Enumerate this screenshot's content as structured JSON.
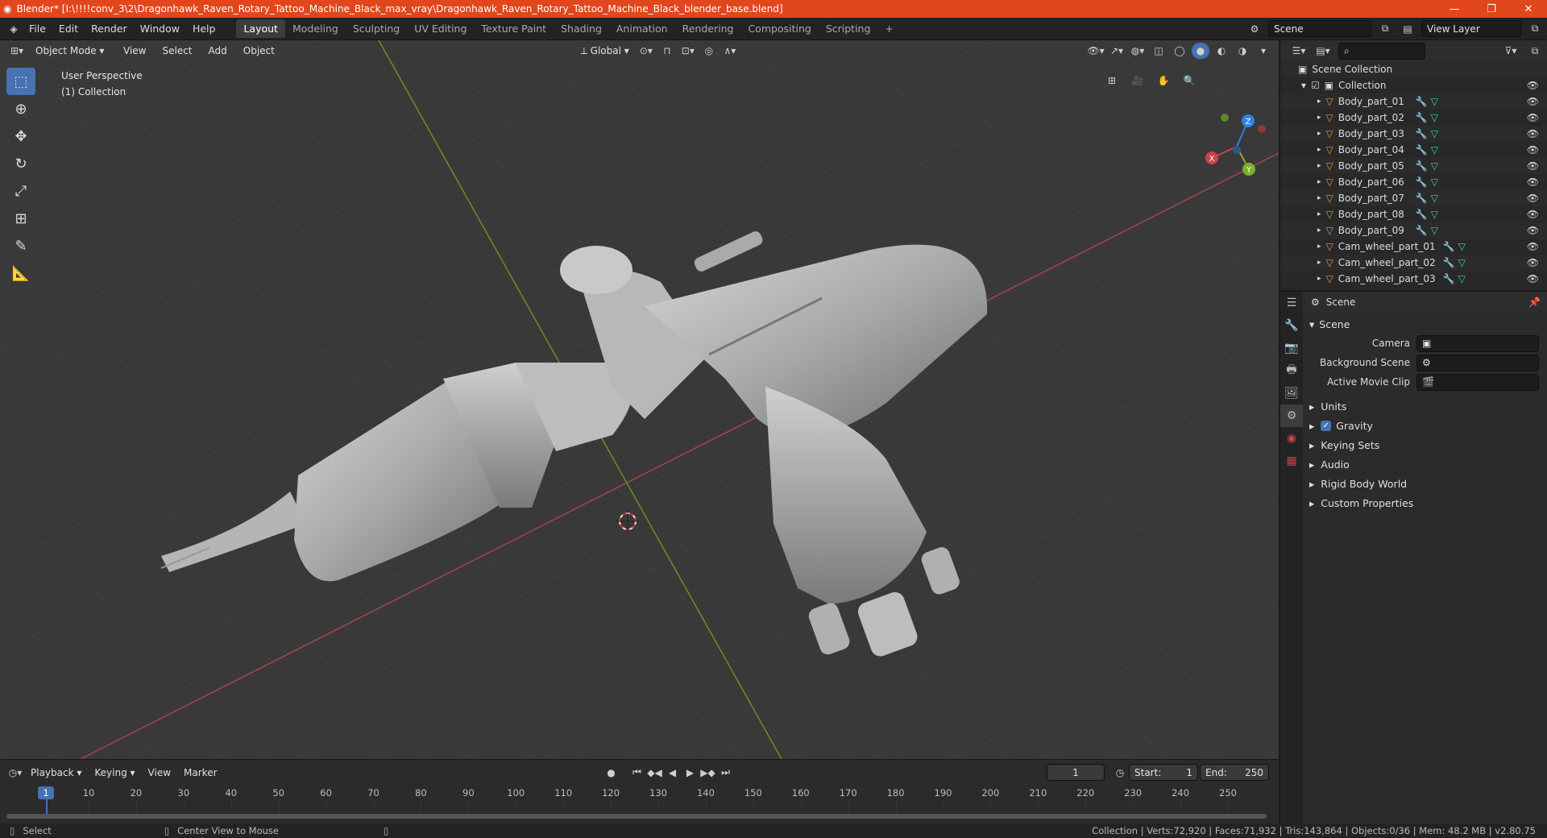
{
  "window": {
    "title": "Blender* [I:\\!!!!conv_3\\2\\Dragonhawk_Raven_Rotary_Tattoo_Machine_Black_max_vray\\Dragonhawk_Raven_Rotary_Tattoo_Machine_Black_blender_base.blend]",
    "minimize": "—",
    "maximize": "❐",
    "close": "✕"
  },
  "menu": [
    "File",
    "Edit",
    "Render",
    "Window",
    "Help"
  ],
  "workspaces": [
    "Layout",
    "Modeling",
    "Sculpting",
    "UV Editing",
    "Texture Paint",
    "Shading",
    "Animation",
    "Rendering",
    "Compositing",
    "Scripting"
  ],
  "active_workspace": "Layout",
  "add_workspace": "+",
  "scene_field": "Scene",
  "view_layer_field": "View Layer",
  "viewport": {
    "mode": "Object Mode",
    "menus": [
      "View",
      "Select",
      "Add",
      "Object"
    ],
    "orientation": "Global",
    "info_line1": "User Perspective",
    "info_line2": "(1) Collection",
    "gizmo_axes": {
      "x": "X",
      "y": "Y",
      "z": "Z"
    }
  },
  "tools": [
    "select-box",
    "cursor",
    "move",
    "rotate",
    "scale",
    "transform",
    "annotate",
    "measure"
  ],
  "outliner": {
    "root": "Scene Collection",
    "collection": "Collection",
    "items": [
      "Body_part_01",
      "Body_part_02",
      "Body_part_03",
      "Body_part_04",
      "Body_part_05",
      "Body_part_06",
      "Body_part_07",
      "Body_part_08",
      "Body_part_09",
      "Cam_wheel_part_01",
      "Cam_wheel_part_02",
      "Cam_wheel_part_03"
    ]
  },
  "properties": {
    "context": "Scene",
    "panel_title": "Scene",
    "camera_label": "Camera",
    "background_scene_label": "Background Scene",
    "active_clip_label": "Active Movie Clip",
    "sections": [
      "Units",
      "Gravity",
      "Keying Sets",
      "Audio",
      "Rigid Body World",
      "Custom Properties"
    ],
    "gravity_checked": true
  },
  "timeline": {
    "menus": [
      "Playback",
      "Keying",
      "View",
      "Marker"
    ],
    "current_frame": "1",
    "start_label": "Start:",
    "start_value": "1",
    "end_label": "End:",
    "end_value": "250",
    "ticks": [
      "1",
      "10",
      "20",
      "30",
      "40",
      "50",
      "60",
      "70",
      "80",
      "90",
      "100",
      "110",
      "120",
      "130",
      "140",
      "150",
      "160",
      "170",
      "180",
      "190",
      "200",
      "210",
      "220",
      "230",
      "240",
      "250"
    ]
  },
  "status": {
    "left": "Select",
    "middle": "Center View to Mouse",
    "right": "Collection | Verts:72,920 | Faces:71,932 | Tris:143,864 | Objects:0/36 | Mem: 48.2 MB | v2.80.75"
  },
  "colors": {
    "titlebar": "#e1461c",
    "accent": "#4772b3",
    "x_axis": "#c9434c",
    "y_axis": "#7ab02b",
    "z_axis": "#2e82e0"
  }
}
